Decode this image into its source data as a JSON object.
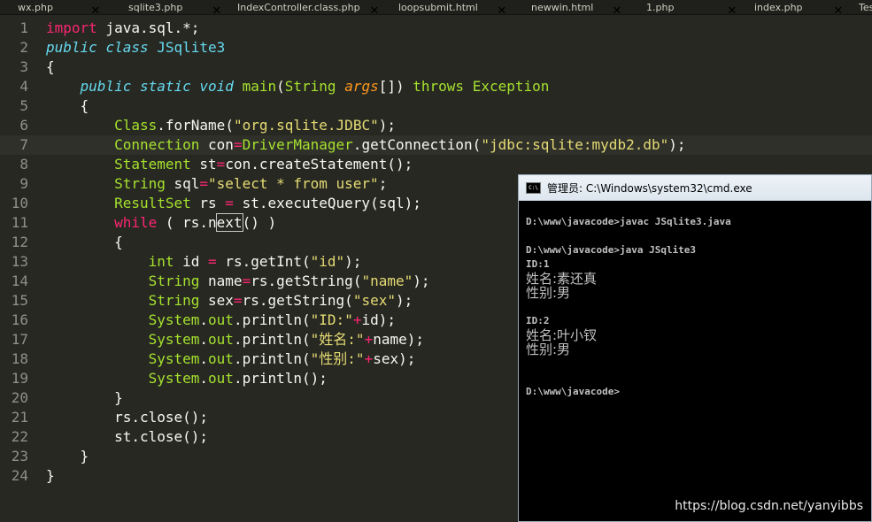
{
  "tabs": [
    {
      "label": "wx.php"
    },
    {
      "label": "sqlite3.php"
    },
    {
      "label": "IndexController.class.php"
    },
    {
      "label": "loopsubmit.html"
    },
    {
      "label": "newwin.html"
    },
    {
      "label": "1.php"
    },
    {
      "label": "index.php"
    },
    {
      "label": "Tes"
    }
  ],
  "tab_close_glyph": "✕",
  "editor": {
    "line_numbers": [
      "1",
      "2",
      "3",
      "4",
      "5",
      "6",
      "7",
      "8",
      "9",
      "10",
      "11",
      "12",
      "13",
      "14",
      "15",
      "16",
      "17",
      "18",
      "19",
      "20",
      "21",
      "22",
      "23",
      "24"
    ],
    "lines": {
      "l1": {
        "a": "import",
        "b": " java.sql.*;"
      },
      "l2": {
        "a": "public",
        "b": " ",
        "c": "class",
        "d": " ",
        "e": "JSqlite3"
      },
      "l3": {
        "a": "{"
      },
      "l4": {
        "ind": "    ",
        "a": "public",
        "b": " ",
        "c": "static",
        "d": " ",
        "e": "void",
        "f": " ",
        "g": "main",
        "h": "(",
        "i": "String",
        "j": " ",
        "k": "args",
        "l": "[]) ",
        "m": "throws",
        "n": " ",
        "o": "Exception"
      },
      "l5": {
        "ind": "    ",
        "a": "{"
      },
      "l6": {
        "ind": "        ",
        "a": "Class",
        "b": ".",
        "c": "forName",
        "d": "(",
        "e": "\"org.sqlite.JDBC\"",
        "f": ");"
      },
      "l7": {
        "ind": "        ",
        "a": "Connection",
        "b": " con",
        "c": "=",
        "d": "DriverManager",
        "e": ".",
        "f": "getConnection",
        "g": "(",
        "h": "\"jdbc:sqlite:mydb2.db\"",
        "i": ");"
      },
      "l8": {
        "ind": "        ",
        "a": "Statement",
        "b": " st",
        "c": "=",
        "d": "con.",
        "e": "createStatement",
        "f": "();"
      },
      "l9": {
        "ind": "        ",
        "a": "String",
        "b": " sql",
        "c": "=",
        "d": "\"select * from user\"",
        "e": ";"
      },
      "l10": {
        "ind": "        ",
        "a": "ResultSet",
        "b": " rs ",
        "c": "=",
        "d": " st.",
        "e": "executeQuery",
        "f": "(sql);"
      },
      "l11": {
        "ind": "        ",
        "a": "while",
        "b": " ( rs.",
        "c": "n",
        "d": "ext",
        "e": "() )"
      },
      "l12": {
        "ind": "        ",
        "a": "{"
      },
      "l13": {
        "ind": "            ",
        "a": "int",
        "b": " id ",
        "c": "=",
        "d": " rs.",
        "e": "getInt",
        "f": "(",
        "g": "\"id\"",
        "h": ");"
      },
      "l14": {
        "ind": "            ",
        "a": "String",
        "b": " name",
        "c": "=",
        "d": "rs.",
        "e": "getString",
        "f": "(",
        "g": "\"name\"",
        "h": ");"
      },
      "l15": {
        "ind": "            ",
        "a": "String",
        "b": " sex",
        "c": "=",
        "d": "rs.",
        "e": "getString",
        "f": "(",
        "g": "\"sex\"",
        "h": ");"
      },
      "l16": {
        "ind": "            ",
        "a": "System",
        "b": ".",
        "c": "out",
        "d": ".",
        "e": "println",
        "f": "(",
        "g": "\"ID:\"",
        "h": "+",
        "i": "id);"
      },
      "l17": {
        "ind": "            ",
        "a": "System",
        "b": ".",
        "c": "out",
        "d": ".",
        "e": "println",
        "f": "(",
        "g": "\"姓名:\"",
        "h": "+",
        "i": "name);"
      },
      "l18": {
        "ind": "            ",
        "a": "System",
        "b": ".",
        "c": "out",
        "d": ".",
        "e": "println",
        "f": "(",
        "g": "\"性别:\"",
        "h": "+",
        "i": "sex);"
      },
      "l19": {
        "ind": "            ",
        "a": "System",
        "b": ".",
        "c": "out",
        "d": ".",
        "e": "println",
        "f": "();"
      },
      "l20": {
        "ind": "        ",
        "a": "}"
      },
      "l21": {
        "ind": "        ",
        "a": "rs.",
        "b": "close",
        "c": "();"
      },
      "l22": {
        "ind": "        ",
        "a": "st.",
        "b": "close",
        "c": "();"
      },
      "l23": {
        "ind": "    ",
        "a": "}"
      },
      "l24": {
        "a": "}"
      }
    }
  },
  "cmd": {
    "title": "管理员: C:\\Windows\\system32\\cmd.exe",
    "icon_text": "C:\\",
    "lines": [
      "D:\\www\\javacode>javac JSqlite3.java",
      "D:\\www\\javacode>java JSqlite3",
      "ID:1",
      "姓名:素还真",
      "性别:男",
      "ID:2",
      "姓名:叶小钗",
      "性别:男",
      "D:\\www\\javacode>"
    ]
  },
  "watermark": "https://blog.csdn.net/yanyibbs"
}
